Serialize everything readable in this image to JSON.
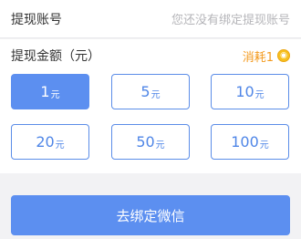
{
  "account": {
    "label": "提现账号",
    "hint": "您还没有绑定提现账号"
  },
  "amount": {
    "title": "提现金额（元）",
    "cost_label": "消耗1",
    "unit": "元",
    "options": [
      {
        "value": "1",
        "selected": true
      },
      {
        "value": "5",
        "selected": false
      },
      {
        "value": "10",
        "selected": false
      },
      {
        "value": "20",
        "selected": false
      },
      {
        "value": "50",
        "selected": false
      },
      {
        "value": "100",
        "selected": false
      }
    ]
  },
  "unbind_button": {
    "label": "去绑定微信"
  },
  "colors": {
    "accent": "#5c8ff0",
    "cost": "#f39a1e",
    "coin": "#f7c01e"
  },
  "icons": {
    "coin": "coin-icon"
  }
}
